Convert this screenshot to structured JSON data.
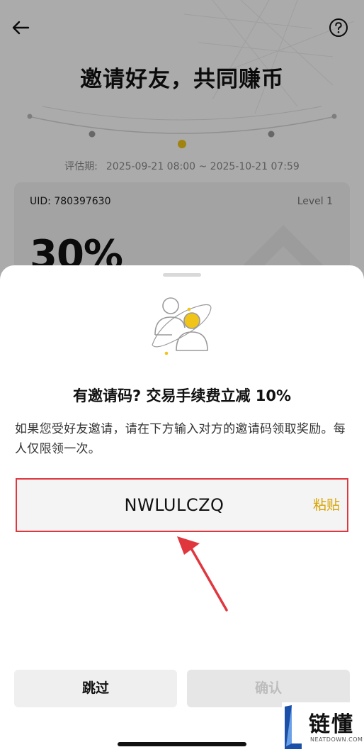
{
  "header": {
    "back_icon": "arrow-left-icon",
    "help_icon": "question-circle-icon",
    "title": "邀请好友，共同赚币"
  },
  "evaluation": {
    "label": "评估期:",
    "period": "2025-09-21 08:00 ~ 2025-10-21 07:59"
  },
  "card": {
    "uid": "UID: 780397630",
    "level": "Level 1",
    "rate": "30%"
  },
  "sheet": {
    "illustration_icon": "invite-friends-icon",
    "title": "有邀请码? 交易手续费立减 10%",
    "description": "如果您受好友邀请，请在下方输入对方的邀请码领取奖励。每人仅限领一次。",
    "code_field": {
      "value": "NWLULCZQ",
      "paste_label": "粘贴"
    },
    "buttons": {
      "skip": "跳过",
      "confirm": "确认"
    }
  },
  "watermark": {
    "brand": "链懂",
    "url": "NEATDOWN.COM"
  },
  "colors": {
    "accent_yellow": "#f0c419",
    "paste_text": "#d8a400",
    "highlight_red": "#e0373f",
    "overlay": "rgba(0,0,0,0.33)"
  }
}
